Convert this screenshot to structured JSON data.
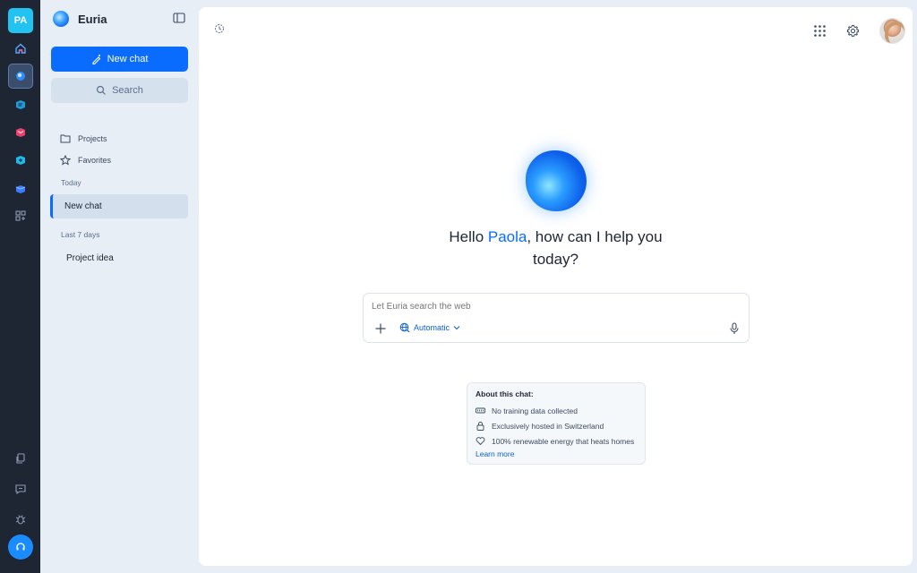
{
  "rail": {
    "avatar_initials": "PA"
  },
  "sidebar": {
    "app_name": "Euria",
    "new_chat_label": "New chat",
    "search_label": "Search",
    "nav": [
      {
        "label": "Projects",
        "icon": "folder-icon"
      },
      {
        "label": "Favorites",
        "icon": "star-icon"
      }
    ],
    "sections": {
      "today": "Today",
      "last_7_days": "Last 7 days"
    },
    "chats_today": [
      {
        "label": "New chat",
        "active": true
      }
    ],
    "chats_last7": [
      {
        "label": "Project idea",
        "active": false
      }
    ]
  },
  "main": {
    "greeting_prefix": "Hello ",
    "user_name": "Paola",
    "greeting_suffix_1": ", how can I help you",
    "greeting_line_2": "today?",
    "composer": {
      "placeholder": "Let Euria search the web",
      "mode_label": "Automatic"
    },
    "about": {
      "title": "About this chat:",
      "items": [
        {
          "label": "No training data collected",
          "icon": "no-data-icon"
        },
        {
          "label": "Exclusively hosted in Switzerland",
          "icon": "lock-icon"
        },
        {
          "label": "100% renewable energy that heats homes",
          "icon": "heart-icon"
        }
      ],
      "learn_more": "Learn more"
    }
  },
  "colors": {
    "accent": "#0a6cff",
    "rail_bg": "#1f2633",
    "sidebar_bg": "#e8eef6"
  }
}
